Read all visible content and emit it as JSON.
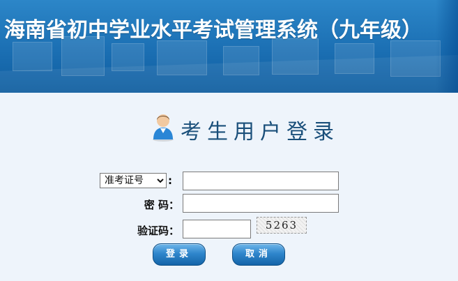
{
  "header": {
    "title": "海南省初中学业水平考试管理系统（九年级）"
  },
  "login": {
    "heading": "考生用户登录",
    "id_type": {
      "selected": "准考证号",
      "options": [
        "准考证号"
      ]
    },
    "colon": ":",
    "id_value": "",
    "password_label": "密  码：",
    "password_value": "",
    "captcha_label": "验证码：",
    "captcha_value": "",
    "captcha_text": "5263",
    "login_button": "登录",
    "cancel_button": "取消"
  },
  "colors": {
    "banner": "#1b6fb3",
    "background": "#eef4fb",
    "button": "#2f86cc",
    "heading": "#1a4f7a"
  }
}
